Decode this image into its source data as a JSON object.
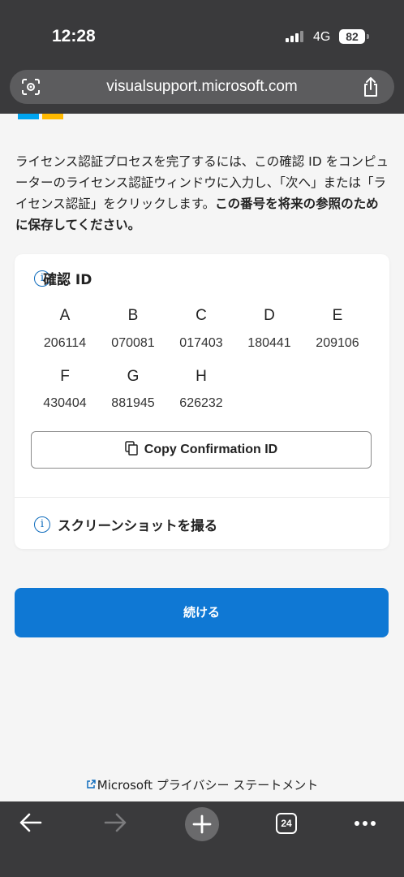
{
  "status_bar": {
    "time": "12:28",
    "network": "4G",
    "battery": "82"
  },
  "browser": {
    "url": "visualsupport.microsoft.com",
    "tab_count": "24"
  },
  "intro": {
    "text": "ライセンス認証プロセスを完了するには、この確認 ID をコンピューターのライセンス認証ウィンドウに入力し、「次へ」または「ライセンス認証」をクリックします。",
    "bold": "この番号を将来の参照のために保存してください。"
  },
  "confirmation": {
    "title": "確認 ID",
    "groups": [
      {
        "label": "A",
        "value": "206114"
      },
      {
        "label": "B",
        "value": "070081"
      },
      {
        "label": "C",
        "value": "017403"
      },
      {
        "label": "D",
        "value": "180441"
      },
      {
        "label": "E",
        "value": "209106"
      },
      {
        "label": "F",
        "value": "430404"
      },
      {
        "label": "G",
        "value": "881945"
      },
      {
        "label": "H",
        "value": "626232"
      }
    ],
    "copy_label": "Copy Confirmation ID",
    "screenshot_label": "スクリーンショットを撮る"
  },
  "continue_label": "続ける",
  "privacy_label": "Microsoft プライバシー ステートメント",
  "colors": {
    "accent": "#0f78d4",
    "chrome": "#3a3a3c"
  },
  "icons": [
    "lens-icon",
    "share-icon",
    "info-icon",
    "copy-icon",
    "external-link-icon",
    "back-arrow-icon",
    "forward-arrow-icon",
    "plus-icon",
    "tabs-icon",
    "more-icon"
  ]
}
